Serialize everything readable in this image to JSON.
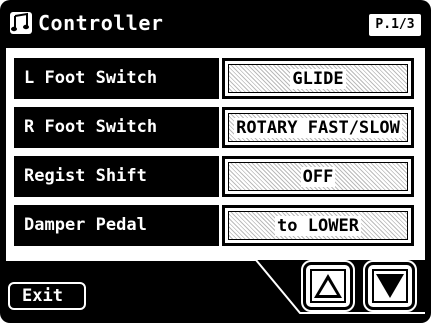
{
  "header": {
    "title": "Controller",
    "page_indicator": "P.1/3",
    "icon": "music-notes-icon"
  },
  "rows": [
    {
      "label": "L Foot Switch",
      "value": "GLIDE"
    },
    {
      "label": "R Foot Switch",
      "value": "ROTARY FAST/SLOW"
    },
    {
      "label": "Regist Shift",
      "value": "OFF"
    },
    {
      "label": "Damper Pedal",
      "value": "to LOWER"
    }
  ],
  "footer": {
    "exit_label": "Exit",
    "up_icon": "arrow-up-icon",
    "down_icon": "arrow-down-icon"
  },
  "colors": {
    "background": "#000000",
    "panel": "#ffffff",
    "text_light": "#ffffff",
    "text_dark": "#000000"
  }
}
